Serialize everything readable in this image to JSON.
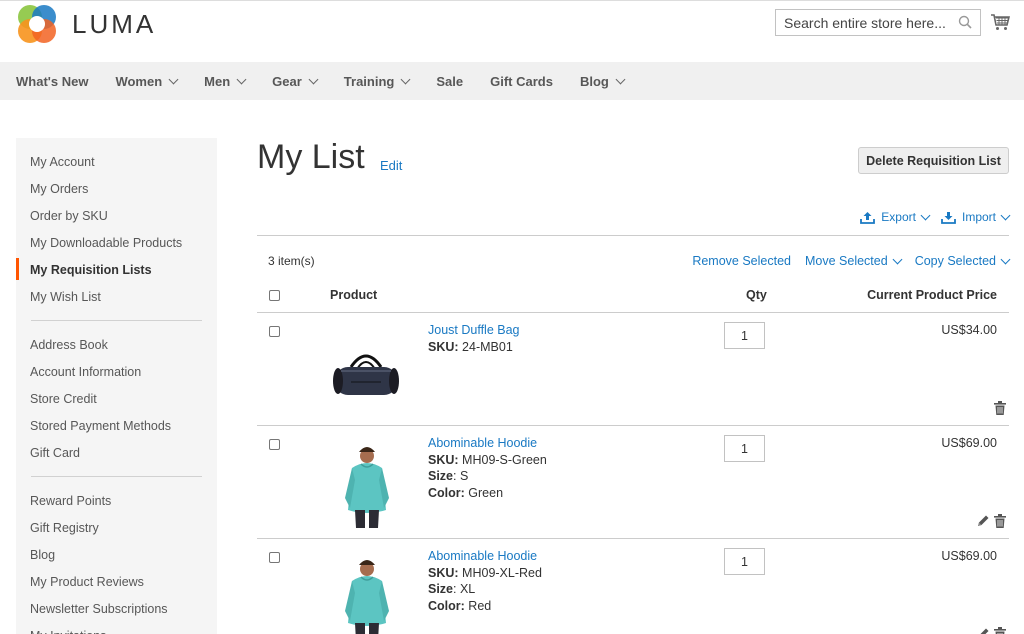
{
  "header": {
    "logo_text": "LUMA",
    "search_placeholder": "Search entire store here...",
    "colors": {
      "brand_orange": "#f26322",
      "brand_green": "#8bc53f",
      "brand_blue": "#1979c3",
      "brand_yellow": "#f7941d"
    }
  },
  "nav": {
    "items": [
      {
        "label": "What's New",
        "dropdown": false
      },
      {
        "label": "Women",
        "dropdown": true
      },
      {
        "label": "Men",
        "dropdown": true
      },
      {
        "label": "Gear",
        "dropdown": true
      },
      {
        "label": "Training",
        "dropdown": true
      },
      {
        "label": "Sale",
        "dropdown": false
      },
      {
        "label": "Gift Cards",
        "dropdown": false
      },
      {
        "label": "Blog",
        "dropdown": true
      }
    ]
  },
  "sidebar": {
    "group1": [
      "My Account",
      "My Orders",
      "Order by SKU",
      "My Downloadable Products",
      "My Requisition Lists",
      "My Wish List"
    ],
    "active": "My Requisition Lists",
    "group2": [
      "Address Book",
      "Account Information",
      "Store Credit",
      "Stored Payment Methods",
      "Gift Card"
    ],
    "group3": [
      "Reward Points",
      "Gift Registry",
      "Blog",
      "My Product Reviews",
      "Newsletter Subscriptions",
      "My Invitations"
    ]
  },
  "main": {
    "title": "My List",
    "edit_label": "Edit",
    "delete_label": "Delete Requisition List",
    "export_label": "Export",
    "import_label": "Import",
    "count_label": "3 item(s)",
    "remove_selected": "Remove Selected",
    "move_selected": "Move Selected",
    "copy_selected": "Copy Selected",
    "col_product": "Product",
    "col_qty": "Qty",
    "col_price": "Current Product Price"
  },
  "items": [
    {
      "name": "Joust Duffle Bag",
      "sku_label": "SKU:",
      "sku": "24-MB01",
      "size_label": "",
      "size": "",
      "color_label": "",
      "color": "",
      "qty": "1",
      "price": "US$34.00",
      "editable": false,
      "image": "duffle-bag"
    },
    {
      "name": "Abominable Hoodie",
      "sku_label": "SKU:",
      "sku": "MH09-S-Green",
      "size_label": "Size",
      "size": "S",
      "color_label": "Color:",
      "color": "Green",
      "qty": "1",
      "price": "US$69.00",
      "editable": true,
      "image": "hoodie"
    },
    {
      "name": "Abominable Hoodie",
      "sku_label": "SKU:",
      "sku": "MH09-XL-Red",
      "size_label": "Size",
      "size": "XL",
      "color_label": "Color:",
      "color": "Red",
      "qty": "1",
      "price": "US$69.00",
      "editable": true,
      "image": "hoodie"
    }
  ]
}
